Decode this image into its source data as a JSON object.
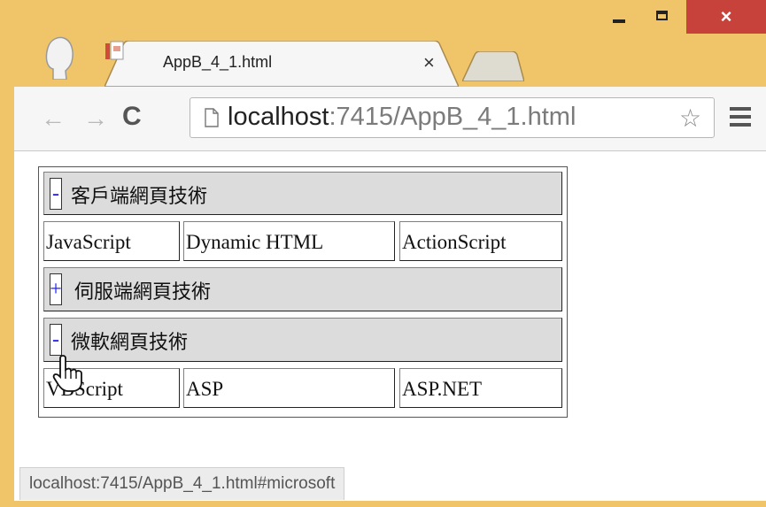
{
  "window": {
    "controls": {
      "minimize": "minimize",
      "maximize": "maximize",
      "close": "×"
    }
  },
  "tab": {
    "title": "AppB_4_1.html",
    "close_label": "×",
    "favicon": "html-file-icon"
  },
  "toolbar": {
    "back_icon": "←",
    "forward_icon": "→",
    "reload_icon": "C",
    "url_host": "localhost",
    "url_rest": ":7415/AppB_4_1.html",
    "bookmark_icon": "☆"
  },
  "page": {
    "groups": [
      {
        "toggle": "-",
        "title": "客戶端網頁技術",
        "expanded": true,
        "items": [
          "JavaScript",
          "Dynamic HTML",
          "ActionScript"
        ]
      },
      {
        "toggle": "+",
        "title": "伺服端網頁技術",
        "expanded": false,
        "items": []
      },
      {
        "toggle": "-",
        "title": "微軟網頁技術",
        "expanded": true,
        "items": [
          "VBScript",
          "ASP",
          "ASP.NET"
        ]
      }
    ]
  },
  "status_bar": {
    "text": "localhost:7415/AppB_4_1.html#microsoft"
  },
  "colors": {
    "frame": "#f0c56a",
    "close_button": "#c8423c",
    "toggle_symbol": "#2020ff",
    "header_bg": "#dcdcdc"
  }
}
